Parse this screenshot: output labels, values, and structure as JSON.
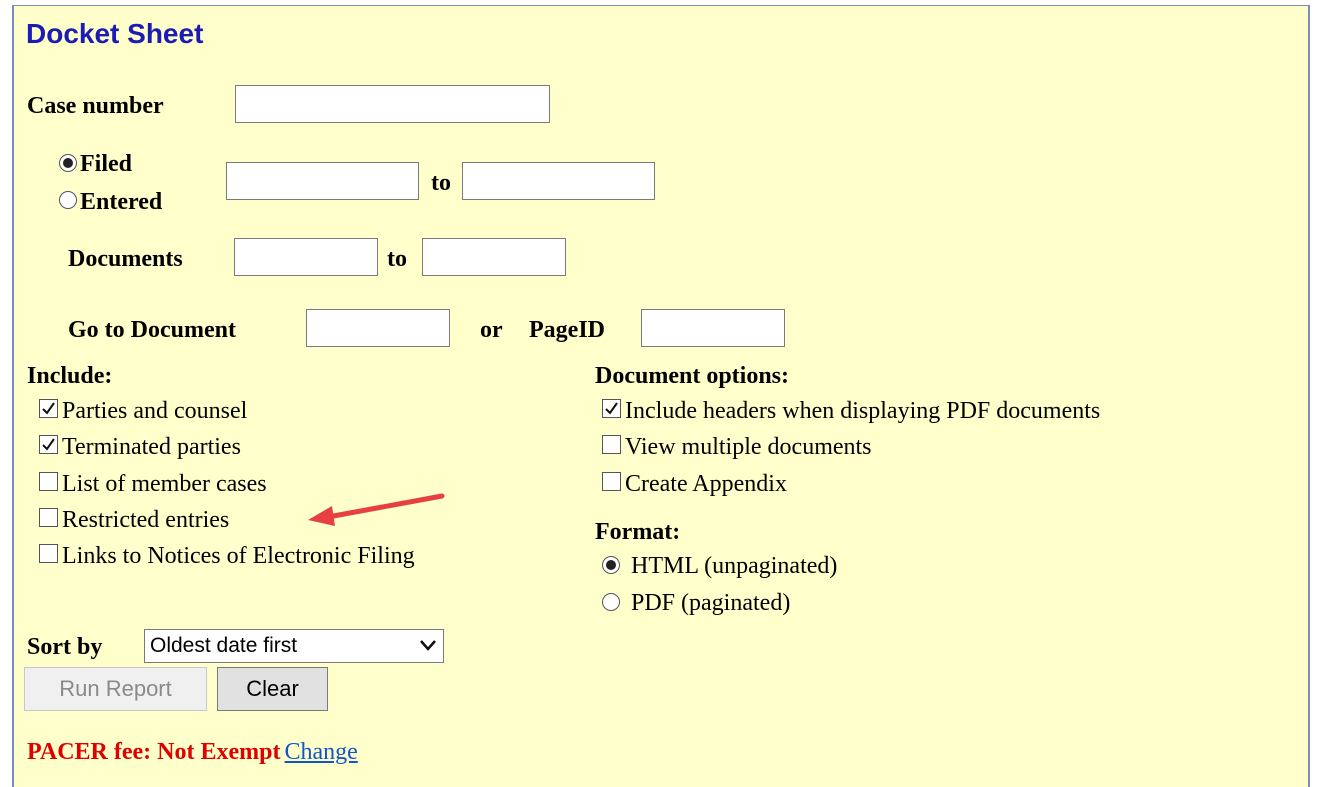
{
  "page": {
    "title": "Docket Sheet"
  },
  "case_number": {
    "label": "Case number",
    "value": ""
  },
  "date_filter": {
    "filed_label": "Filed",
    "entered_label": "Entered",
    "selected": "Filed",
    "to_label": "to",
    "from_value": "",
    "to_value": ""
  },
  "documents": {
    "label": "Documents",
    "to_label": "to",
    "from_value": "",
    "to_value": ""
  },
  "goto": {
    "label": "Go to Document",
    "or_label": "or",
    "pageid_label": "PageID",
    "document_value": "",
    "pageid_value": ""
  },
  "include": {
    "heading": "Include:",
    "items": [
      {
        "label": "Parties and counsel",
        "checked": true
      },
      {
        "label": "Terminated parties",
        "checked": true
      },
      {
        "label": "List of member cases",
        "checked": false
      },
      {
        "label": "Restricted entries",
        "checked": false
      },
      {
        "label": "Links to Notices of Electronic Filing",
        "checked": false
      }
    ]
  },
  "document_options": {
    "heading": "Document options:",
    "items": [
      {
        "label": "Include headers when displaying PDF documents",
        "checked": true
      },
      {
        "label": "View multiple documents",
        "checked": false
      },
      {
        "label": "Create Appendix",
        "checked": false
      }
    ]
  },
  "format": {
    "heading": "Format:",
    "options": [
      {
        "label": "HTML (unpaginated)",
        "selected": true
      },
      {
        "label": "PDF (paginated)",
        "selected": false
      }
    ]
  },
  "sort": {
    "label": "Sort by",
    "selected": "Oldest date first"
  },
  "buttons": {
    "run_label": "Run Report",
    "clear_label": "Clear"
  },
  "fee": {
    "text": "PACER fee: Not Exempt",
    "change_label": "Change"
  },
  "colors": {
    "background": "#ffffcc",
    "title": "#1b1bb5",
    "fee": "#e00000",
    "link": "#1155cc",
    "annotation_arrow": "#e84040"
  },
  "icons": {
    "checkbox": "checkmark-icon",
    "radio": "radio-dot-icon",
    "dropdown": "chevron-down-icon",
    "annotation": "red-arrow-icon"
  }
}
